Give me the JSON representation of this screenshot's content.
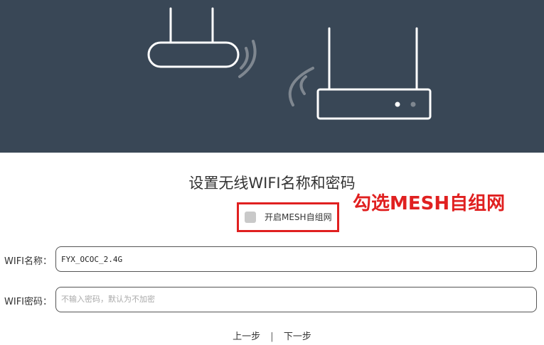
{
  "hero": {
    "background": "#394756"
  },
  "title": "设置无线WIFI名称和密码",
  "mesh": {
    "label": "开启MESH自组网",
    "checked": false
  },
  "annotation": "勾选MESH自组网",
  "wifi_name": {
    "label": "WIFI名称：",
    "value": "FYX_OCOC_2.4G"
  },
  "wifi_password": {
    "label": "WIFI密码：",
    "placeholder": "不输入密码，默认为不加密"
  },
  "nav": {
    "prev": "上一步",
    "separator": "|",
    "next": "下一步"
  },
  "colors": {
    "accent_annotation": "#e02020",
    "header_bg": "#394756"
  }
}
